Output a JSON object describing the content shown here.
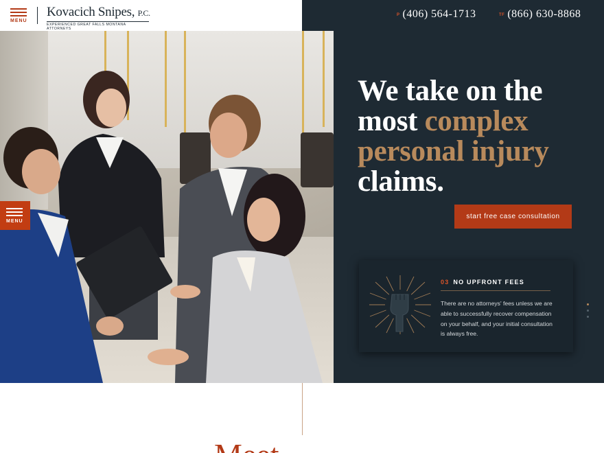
{
  "header": {
    "menu_label": "MENU",
    "logo_name": "Kovacich Snipes,",
    "logo_suffix": "P.C.",
    "logo_tagline": "EXPERIENCED GREAT FALLS MONTANA ATTORNEYS",
    "phones": [
      {
        "prefix": "P",
        "number": "(406) 564-1713"
      },
      {
        "prefix": "TF",
        "number": "(866) 630-8868"
      }
    ]
  },
  "sidebar_menu": {
    "label": "MENU"
  },
  "hero": {
    "headline_line1": "We take on the",
    "headline_line2_plain": "most ",
    "headline_line2_accent": "complex",
    "headline_line3_accent": "personal injury",
    "headline_line4": "claims.",
    "cta_label": "start free case consultation"
  },
  "feature_card": {
    "number": "03",
    "title": "NO UPFRONT FEES",
    "body": "There are no attorneys' fees unless we are able to successfully recover compensation on your behalf, and your initial consultation is always free."
  },
  "slider": {
    "total": 3,
    "active": 1
  },
  "bottom": {
    "heading_partial": "Meet"
  },
  "colors": {
    "navy": "#1e2a33",
    "accent_orange": "#b33a17",
    "accent_gold": "#b88a5c",
    "number_orange": "#d9542a"
  }
}
